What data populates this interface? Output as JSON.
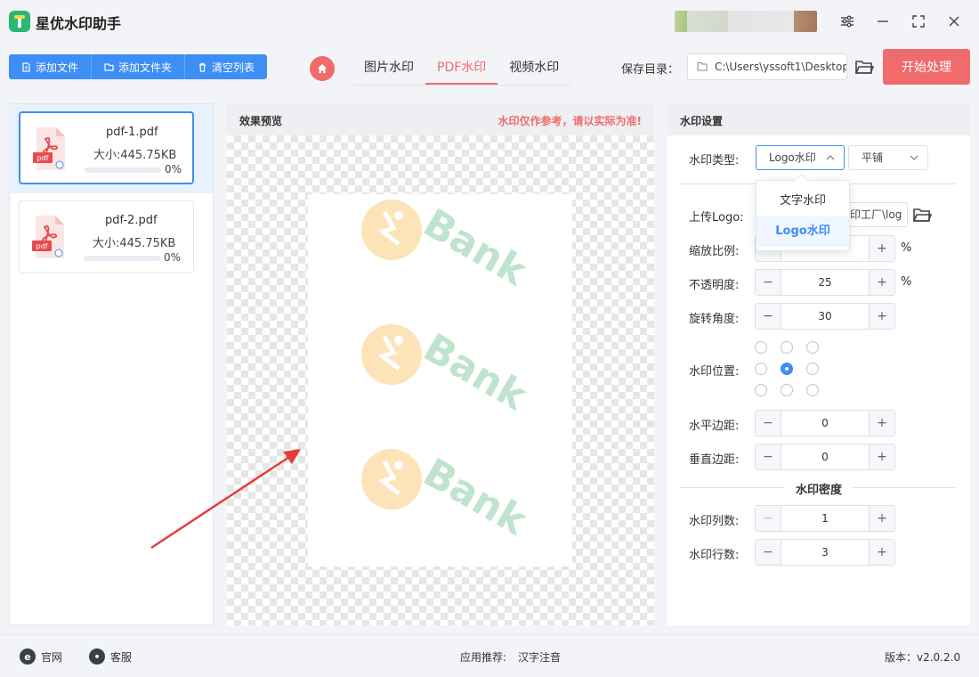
{
  "app": {
    "title": "星优水印助手"
  },
  "toolbar": {
    "add_file": "添加文件",
    "add_folder": "添加文件夹",
    "clear_list": "清空列表",
    "tabs": [
      {
        "label": "图片水印",
        "active": false
      },
      {
        "label": "PDF水印",
        "active": true
      },
      {
        "label": "视频水印",
        "active": false
      }
    ],
    "save_label": "保存目录：",
    "save_path": "C:\\Users\\yssoft1\\Desktop",
    "start": "开始处理"
  },
  "files": [
    {
      "name": "pdf-1.pdf",
      "size": "大小:445.75KB",
      "progress": 0,
      "progress_text": "0%",
      "selected": true
    },
    {
      "name": "pdf-2.pdf",
      "size": "大小:445.75KB",
      "progress": 0,
      "progress_text": "0%",
      "selected": false
    }
  ],
  "preview": {
    "title": "效果预览",
    "note": "水印仅作参考，请以实际为准!",
    "watermark_text": "Bank",
    "watermark_count": 3
  },
  "settings": {
    "title": "水印设置",
    "type_label": "水印类型:",
    "type_value": "Logo水印",
    "layout_value": "平铺",
    "dropdown_options": [
      {
        "label": "文字水印",
        "active": false
      },
      {
        "label": "Logo水印",
        "active": true
      }
    ],
    "upload_label": "上传Logo:",
    "upload_value": "印工厂\\log",
    "scale_label": "缩放比例:",
    "scale_value": "",
    "opacity_label": "不透明度:",
    "opacity_value": "25",
    "rotation_label": "旋转角度:",
    "rotation_value": "30",
    "position_label": "水印位置:",
    "position_selected": 4,
    "hmargin_label": "水平边距:",
    "hmargin_value": "0",
    "vmargin_label": "垂直边距:",
    "vmargin_value": "0",
    "density_title": "水印密度",
    "cols_label": "水印列数:",
    "cols_value": "1",
    "rows_label": "水印行数:",
    "rows_value": "3",
    "percent": "%"
  },
  "footer": {
    "official": "官网",
    "support": "客服",
    "recommend_label": "应用推荐:",
    "recommend_app": "汉字注音",
    "version": "版本：v2.0.2.0"
  },
  "colors": {
    "accent_blue": "#3d8ef5",
    "accent_red": "#f06b6b",
    "watermark_green": "#bfe3cd",
    "watermark_orange": "#fde3b8"
  }
}
